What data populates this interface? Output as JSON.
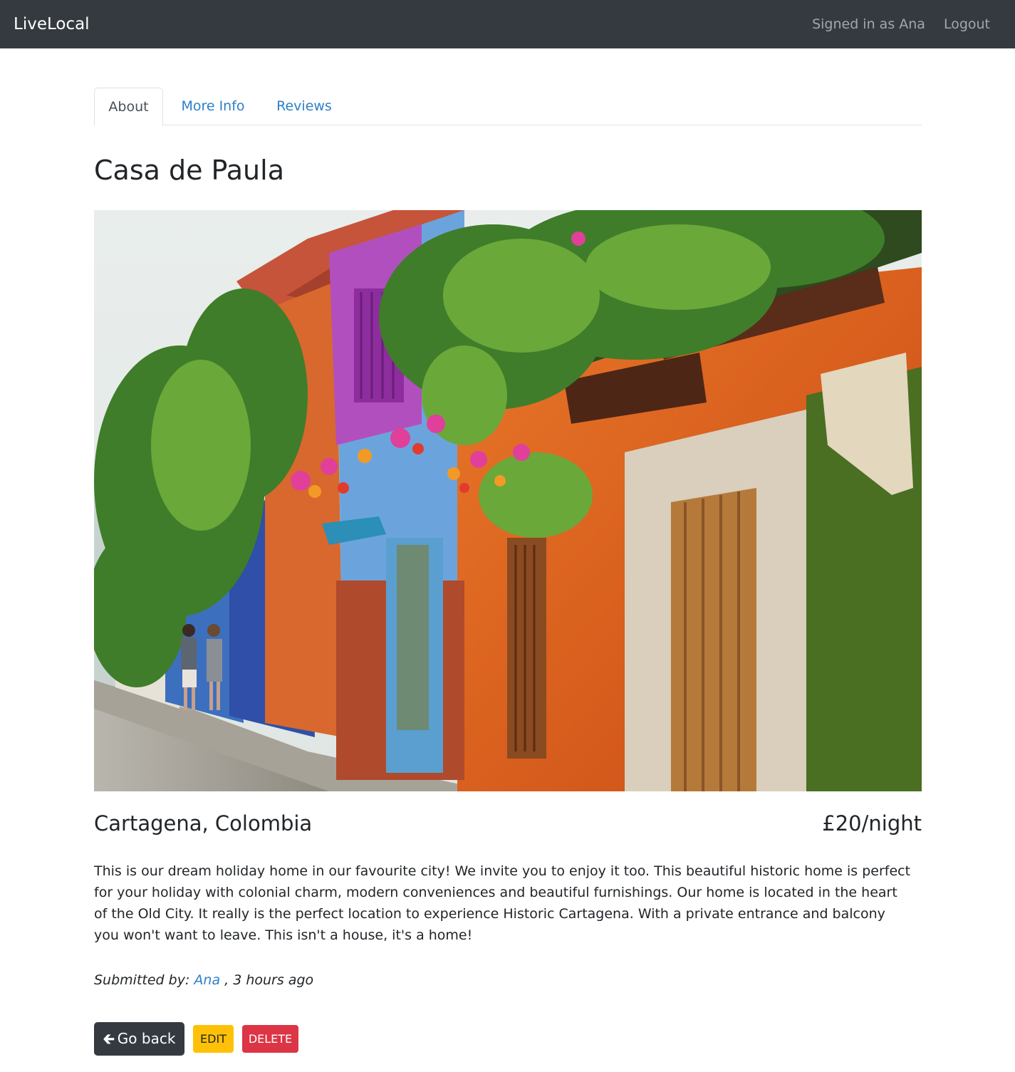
{
  "navbar": {
    "brand": "LiveLocal",
    "signed_in_text": "Signed in as Ana",
    "logout_label": "Logout"
  },
  "tabs": [
    {
      "label": "About",
      "active": true
    },
    {
      "label": "More Info",
      "active": false
    },
    {
      "label": "Reviews",
      "active": false
    }
  ],
  "listing": {
    "title": "Casa de Paula",
    "location": "Cartagena, Colombia",
    "price": "£20/night",
    "description": "This is our dream holiday home in our favourite city! We invite you to enjoy it too. This beautiful historic home is perfect for your holiday with colonial charm, modern conveniences and beautiful furnishings. Our home is located in the heart of the Old City. It really is the perfect location to experience Historic Cartagena. With a private entrance and balcony you won't want to leave. This isn't a house, it's a home!",
    "submitted_prefix": "Submitted by:",
    "author": "Ana",
    "submitted_suffix": ", 3 hours ago"
  },
  "actions": {
    "back_icon": "arrow-left-icon",
    "back_label": "Go back",
    "edit_label": "EDIT",
    "delete_label": "DELETE"
  },
  "colors": {
    "navbar_bg": "#343a40",
    "link": "#2c7fc9",
    "edit_bg": "#ffc107",
    "delete_bg": "#dc3545"
  }
}
